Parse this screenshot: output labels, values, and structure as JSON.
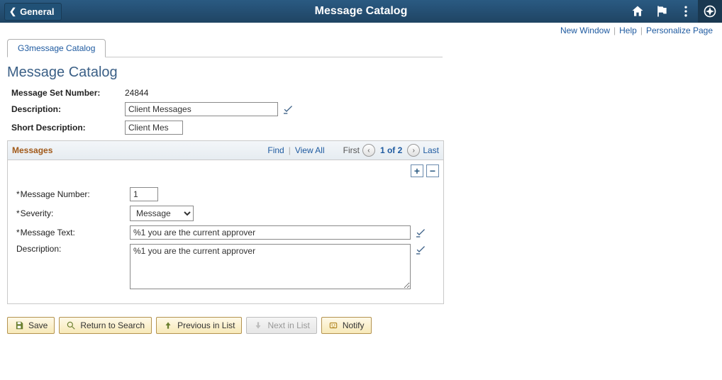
{
  "header": {
    "back_label": "General",
    "title": "Message Catalog"
  },
  "links": {
    "new_window": "New Window",
    "help": "Help",
    "personalize": "Personalize Page"
  },
  "tab": {
    "label": "G3message Catalog"
  },
  "page_title": "Message Catalog",
  "fields": {
    "set_number_label": "Message Set Number:",
    "set_number_value": "24844",
    "description_label": "Description:",
    "description_value": "Client Messages",
    "short_desc_label": "Short Description:",
    "short_desc_value": "Client Mes"
  },
  "section": {
    "title": "Messages",
    "find": "Find",
    "view_all": "View All",
    "first": "First",
    "page": "1 of 2",
    "last": "Last"
  },
  "msg": {
    "number_label": "Message Number:",
    "number_value": "1",
    "severity_label": "Severity:",
    "severity_value": "Message",
    "text_label": "Message Text:",
    "text_value": "%1 you are the current approver",
    "desc_label": "Description:",
    "desc_value": "%1 you are the current approver"
  },
  "buttons": {
    "save": "Save",
    "return": "Return to Search",
    "prev": "Previous in List",
    "next": "Next in List",
    "notify": "Notify"
  }
}
